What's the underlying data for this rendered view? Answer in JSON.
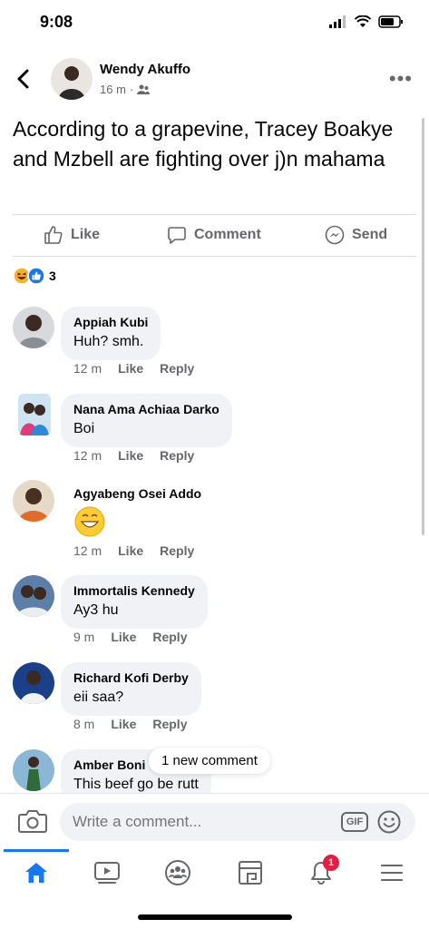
{
  "status_bar": {
    "time": "9:08"
  },
  "post": {
    "author": "Wendy Akuffo",
    "time": "16 m",
    "text": "According to a grapevine, Tracey Boakye and Mzbell are fighting over j)n mahama",
    "reaction_count": "3"
  },
  "actions": {
    "like": "Like",
    "comment": "Comment",
    "send": "Send"
  },
  "comments": [
    {
      "name": "Appiah Kubi",
      "text": "Huh? smh.",
      "time": "12 m",
      "like": "Like",
      "reply": "Reply"
    },
    {
      "name": "Nana Ama Achiaa Darko",
      "text": "Boi",
      "time": "12 m",
      "like": "Like",
      "reply": "Reply"
    },
    {
      "name": "Agyabeng Osei Addo",
      "text": "",
      "time": "12 m",
      "like": "Like",
      "reply": "Reply"
    },
    {
      "name": "Immortalis Kennedy",
      "text": "Ay3 hu",
      "time": "9 m",
      "like": "Like",
      "reply": "Reply"
    },
    {
      "name": "Richard Kofi Derby",
      "text": "eii saa?",
      "time": "8 m",
      "like": "Like",
      "reply": "Reply"
    },
    {
      "name": "Amber Boni",
      "text": "This beef go be rutt"
    }
  ],
  "new_comment_toast": "1 new comment",
  "composer": {
    "placeholder": "Write a comment...",
    "gif_label": "GIF"
  },
  "tabbar": {
    "notification_badge": "1"
  },
  "colors": {
    "accent": "#1877f2",
    "badge": "#e41e3f",
    "bubble": "#f0f2f5",
    "meta": "#65676b"
  }
}
